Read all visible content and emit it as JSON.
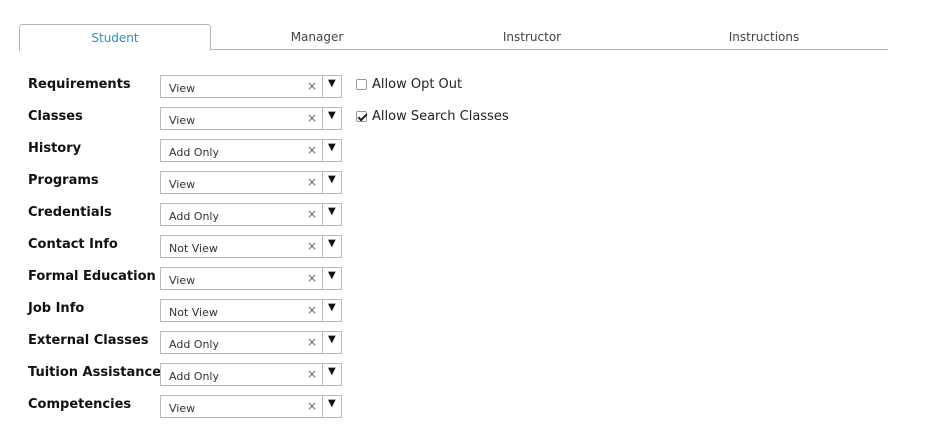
{
  "tabs": [
    {
      "label": "Student",
      "active": true
    },
    {
      "label": "Manager",
      "active": false
    },
    {
      "label": "Instructor",
      "active": false
    },
    {
      "label": "Instructions",
      "active": false
    }
  ],
  "permissions": [
    {
      "label": "Requirements",
      "value": "View",
      "option": {
        "label": "Allow Opt Out",
        "checked": false
      }
    },
    {
      "label": "Classes",
      "value": "View",
      "option": {
        "label": "Allow Search Classes",
        "checked": true
      }
    },
    {
      "label": "History",
      "value": "Add Only"
    },
    {
      "label": "Programs",
      "value": "View"
    },
    {
      "label": "Credentials",
      "value": "Add Only"
    },
    {
      "label": "Contact Info",
      "value": "Not View"
    },
    {
      "label": "Formal Education",
      "value": "View"
    },
    {
      "label": "Job Info",
      "value": "Not View"
    },
    {
      "label": "External Classes",
      "value": "Add Only"
    },
    {
      "label": "Tuition Assistance",
      "value": "Add Only"
    },
    {
      "label": "Competencies",
      "value": "View"
    }
  ],
  "glyphs": {
    "clear": "×",
    "dropdown": "▼"
  },
  "colors": {
    "active_tab": "#2d8fc0"
  }
}
